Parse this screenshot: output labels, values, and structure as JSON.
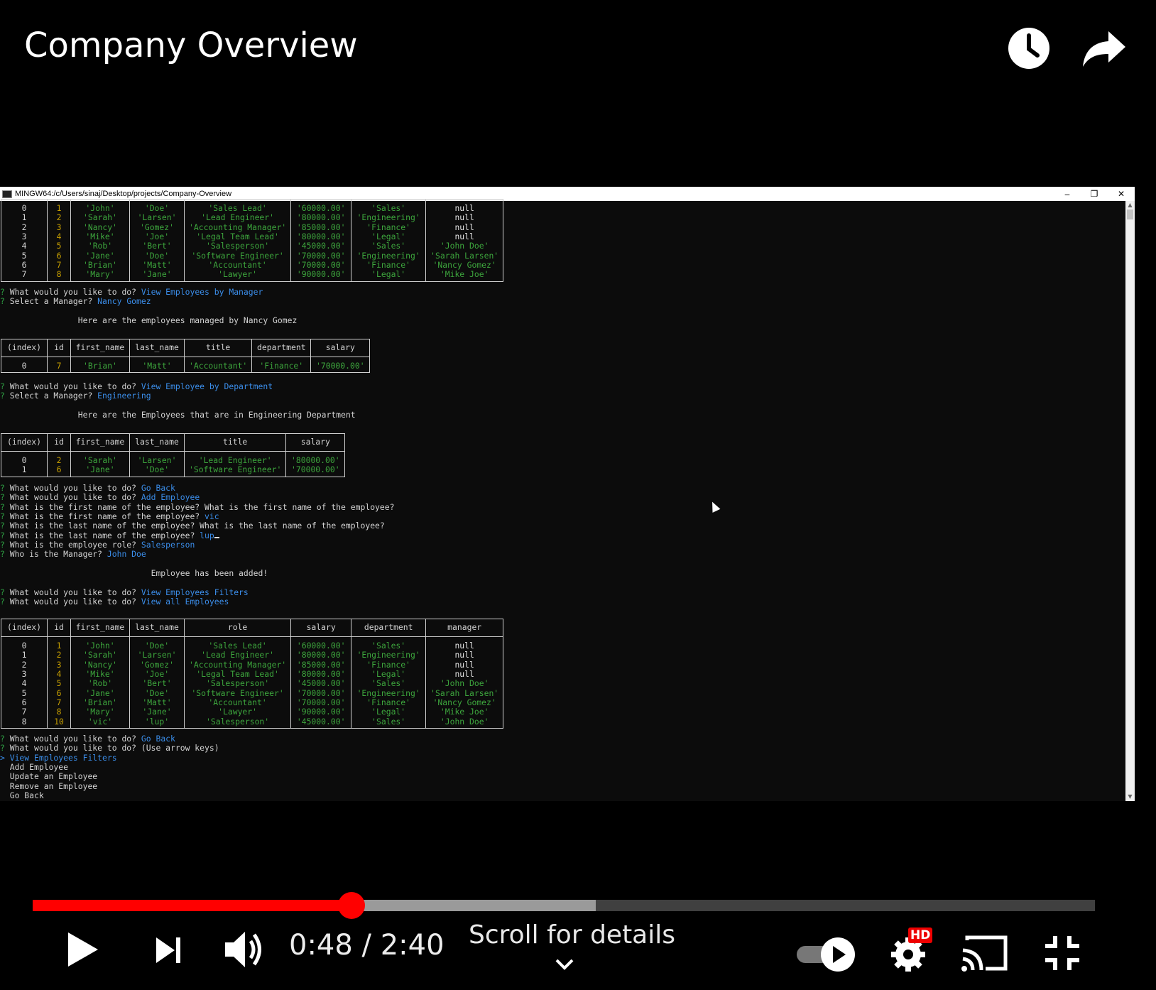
{
  "video": {
    "title": "Company Overview",
    "current_time": "0:48",
    "duration": "2:40",
    "time_display": "0:48 / 2:40",
    "played_fraction": 0.3,
    "buffered_fraction": 0.53,
    "scroll_hint": "Scroll for details",
    "hd_badge": "HD",
    "accent_color": "#ff0000"
  },
  "terminal": {
    "title": "MINGW64:/c/Users/sinaj/Desktop/projects/Company-Overview",
    "window_buttons": [
      "–",
      "❐",
      "✕"
    ]
  },
  "tables": {
    "manager_table": {
      "columns": [
        "(index)",
        "id",
        "first_name",
        "last_name",
        "title",
        "department",
        "salary"
      ],
      "rows": [
        [
          "0",
          "7",
          "'Brian'",
          "'Matt'",
          "'Accountant'",
          "'Finance'",
          "'70000.00'"
        ]
      ]
    },
    "department_table": {
      "columns": [
        "(index)",
        "id",
        "first_name",
        "last_name",
        "title",
        "salary"
      ],
      "rows": [
        [
          "0",
          "2",
          "'Sarah'",
          "'Larsen'",
          "'Lead Engineer'",
          "'80000.00'"
        ],
        [
          "1",
          "6",
          "'Jane'",
          "'Doe'",
          "'Software Engineer'",
          "'70000.00'"
        ]
      ]
    },
    "all_employees_table": {
      "columns": [
        "(index)",
        "id",
        "first_name",
        "last_name",
        "role",
        "salary",
        "department",
        "manager"
      ]
    }
  },
  "icons": [
    "watch-later-icon",
    "share-icon",
    "play-icon",
    "next-icon",
    "volume-icon",
    "autoplay-toggle-icon",
    "settings-icon",
    "cast-icon",
    "exit-fullscreen-icon",
    "chevron-down-icon"
  ]
}
